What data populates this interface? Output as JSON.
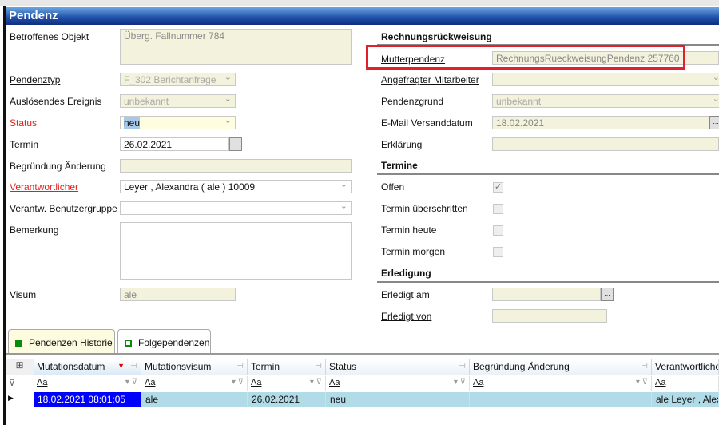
{
  "window": {
    "title": "Pendenz"
  },
  "left": {
    "betroffenes_objekt": {
      "label": "Betroffenes Objekt",
      "value": "Überg. Fallnummer 784"
    },
    "pendenztyp": {
      "label": "Pendenztyp",
      "value": "F_302 Berichtanfrage"
    },
    "ausloesendes_ereignis": {
      "label": "Auslösendes Ereignis",
      "value": "unbekannt"
    },
    "status": {
      "label": "Status",
      "value": "neu"
    },
    "termin": {
      "label": "Termin",
      "value": "26.02.2021",
      "button": "..."
    },
    "begruendung": {
      "label": "Begründung Änderung",
      "value": ""
    },
    "verantwortlicher": {
      "label": "Verantwortlicher",
      "value": "Leyer , Alexandra  ( ale ) 10009"
    },
    "benutzergruppe": {
      "label": "Verantw. Benutzergruppe",
      "value": ""
    },
    "bemerkung": {
      "label": "Bemerkung",
      "value": ""
    },
    "visum": {
      "label": "Visum",
      "value": "ale"
    }
  },
  "right": {
    "section_rechnung": "Rechnungsrückweisung",
    "mutterpendenz": {
      "label": "Mutterpendenz",
      "value": "RechnungsRueckweisungPendenz 257760"
    },
    "angefragter": {
      "label": "Angefragter Mitarbeiter",
      "value": ""
    },
    "pendenzgrund": {
      "label": "Pendenzgrund",
      "value": "unbekannt"
    },
    "email_datum": {
      "label": "E-Mail Versanddatum",
      "value": "18.02.2021",
      "button": "..."
    },
    "erklaerung": {
      "label": "Erklärung",
      "value": ""
    },
    "section_termine": "Termine",
    "offen": {
      "label": "Offen",
      "checked": true
    },
    "ueberschritten": {
      "label": "Termin überschritten",
      "checked": false
    },
    "heute": {
      "label": "Termin heute",
      "checked": false
    },
    "morgen": {
      "label": "Termin morgen",
      "checked": false
    },
    "section_erledigung": "Erledigung",
    "erledigt_am": {
      "label": "Erledigt am",
      "value": "",
      "button": "..."
    },
    "erledigt_von": {
      "label": "Erledigt von",
      "value": ""
    }
  },
  "tabs": [
    {
      "label": "Pendenzen Historie",
      "active": true
    },
    {
      "label": "Folgependenzen",
      "active": false
    }
  ],
  "grid": {
    "columns": [
      "Mutationsdatum",
      "Mutationsvisum",
      "Termin",
      "Status",
      "Begründung Änderung",
      "Verantwortliche"
    ],
    "filter_text": "Aa",
    "rows": [
      [
        "18.02.2021 08:01:05",
        "ale",
        "26.02.2021",
        "neu",
        "",
        "ale Leyer , Alexandra"
      ]
    ]
  },
  "colors": {
    "highlight": "#e0202a",
    "title_bar": "#1f4fa8",
    "selected_row": "#b2dbe8",
    "selected_cell": "#0000ff"
  }
}
